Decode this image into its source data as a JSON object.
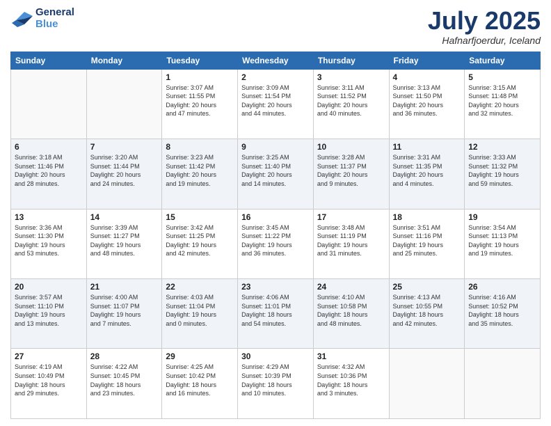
{
  "header": {
    "logo_general": "General",
    "logo_blue": "Blue",
    "month_title": "July 2025",
    "location": "Hafnarfjoerdur, Iceland"
  },
  "days_of_week": [
    "Sunday",
    "Monday",
    "Tuesday",
    "Wednesday",
    "Thursday",
    "Friday",
    "Saturday"
  ],
  "weeks": [
    [
      {
        "day": "",
        "info": ""
      },
      {
        "day": "",
        "info": ""
      },
      {
        "day": "1",
        "info": "Sunrise: 3:07 AM\nSunset: 11:55 PM\nDaylight: 20 hours\nand 47 minutes."
      },
      {
        "day": "2",
        "info": "Sunrise: 3:09 AM\nSunset: 11:54 PM\nDaylight: 20 hours\nand 44 minutes."
      },
      {
        "day": "3",
        "info": "Sunrise: 3:11 AM\nSunset: 11:52 PM\nDaylight: 20 hours\nand 40 minutes."
      },
      {
        "day": "4",
        "info": "Sunrise: 3:13 AM\nSunset: 11:50 PM\nDaylight: 20 hours\nand 36 minutes."
      },
      {
        "day": "5",
        "info": "Sunrise: 3:15 AM\nSunset: 11:48 PM\nDaylight: 20 hours\nand 32 minutes."
      }
    ],
    [
      {
        "day": "6",
        "info": "Sunrise: 3:18 AM\nSunset: 11:46 PM\nDaylight: 20 hours\nand 28 minutes."
      },
      {
        "day": "7",
        "info": "Sunrise: 3:20 AM\nSunset: 11:44 PM\nDaylight: 20 hours\nand 24 minutes."
      },
      {
        "day": "8",
        "info": "Sunrise: 3:23 AM\nSunset: 11:42 PM\nDaylight: 20 hours\nand 19 minutes."
      },
      {
        "day": "9",
        "info": "Sunrise: 3:25 AM\nSunset: 11:40 PM\nDaylight: 20 hours\nand 14 minutes."
      },
      {
        "day": "10",
        "info": "Sunrise: 3:28 AM\nSunset: 11:37 PM\nDaylight: 20 hours\nand 9 minutes."
      },
      {
        "day": "11",
        "info": "Sunrise: 3:31 AM\nSunset: 11:35 PM\nDaylight: 20 hours\nand 4 minutes."
      },
      {
        "day": "12",
        "info": "Sunrise: 3:33 AM\nSunset: 11:32 PM\nDaylight: 19 hours\nand 59 minutes."
      }
    ],
    [
      {
        "day": "13",
        "info": "Sunrise: 3:36 AM\nSunset: 11:30 PM\nDaylight: 19 hours\nand 53 minutes."
      },
      {
        "day": "14",
        "info": "Sunrise: 3:39 AM\nSunset: 11:27 PM\nDaylight: 19 hours\nand 48 minutes."
      },
      {
        "day": "15",
        "info": "Sunrise: 3:42 AM\nSunset: 11:25 PM\nDaylight: 19 hours\nand 42 minutes."
      },
      {
        "day": "16",
        "info": "Sunrise: 3:45 AM\nSunset: 11:22 PM\nDaylight: 19 hours\nand 36 minutes."
      },
      {
        "day": "17",
        "info": "Sunrise: 3:48 AM\nSunset: 11:19 PM\nDaylight: 19 hours\nand 31 minutes."
      },
      {
        "day": "18",
        "info": "Sunrise: 3:51 AM\nSunset: 11:16 PM\nDaylight: 19 hours\nand 25 minutes."
      },
      {
        "day": "19",
        "info": "Sunrise: 3:54 AM\nSunset: 11:13 PM\nDaylight: 19 hours\nand 19 minutes."
      }
    ],
    [
      {
        "day": "20",
        "info": "Sunrise: 3:57 AM\nSunset: 11:10 PM\nDaylight: 19 hours\nand 13 minutes."
      },
      {
        "day": "21",
        "info": "Sunrise: 4:00 AM\nSunset: 11:07 PM\nDaylight: 19 hours\nand 7 minutes."
      },
      {
        "day": "22",
        "info": "Sunrise: 4:03 AM\nSunset: 11:04 PM\nDaylight: 19 hours\nand 0 minutes."
      },
      {
        "day": "23",
        "info": "Sunrise: 4:06 AM\nSunset: 11:01 PM\nDaylight: 18 hours\nand 54 minutes."
      },
      {
        "day": "24",
        "info": "Sunrise: 4:10 AM\nSunset: 10:58 PM\nDaylight: 18 hours\nand 48 minutes."
      },
      {
        "day": "25",
        "info": "Sunrise: 4:13 AM\nSunset: 10:55 PM\nDaylight: 18 hours\nand 42 minutes."
      },
      {
        "day": "26",
        "info": "Sunrise: 4:16 AM\nSunset: 10:52 PM\nDaylight: 18 hours\nand 35 minutes."
      }
    ],
    [
      {
        "day": "27",
        "info": "Sunrise: 4:19 AM\nSunset: 10:49 PM\nDaylight: 18 hours\nand 29 minutes."
      },
      {
        "day": "28",
        "info": "Sunrise: 4:22 AM\nSunset: 10:45 PM\nDaylight: 18 hours\nand 23 minutes."
      },
      {
        "day": "29",
        "info": "Sunrise: 4:25 AM\nSunset: 10:42 PM\nDaylight: 18 hours\nand 16 minutes."
      },
      {
        "day": "30",
        "info": "Sunrise: 4:29 AM\nSunset: 10:39 PM\nDaylight: 18 hours\nand 10 minutes."
      },
      {
        "day": "31",
        "info": "Sunrise: 4:32 AM\nSunset: 10:36 PM\nDaylight: 18 hours\nand 3 minutes."
      },
      {
        "day": "",
        "info": ""
      },
      {
        "day": "",
        "info": ""
      }
    ]
  ]
}
